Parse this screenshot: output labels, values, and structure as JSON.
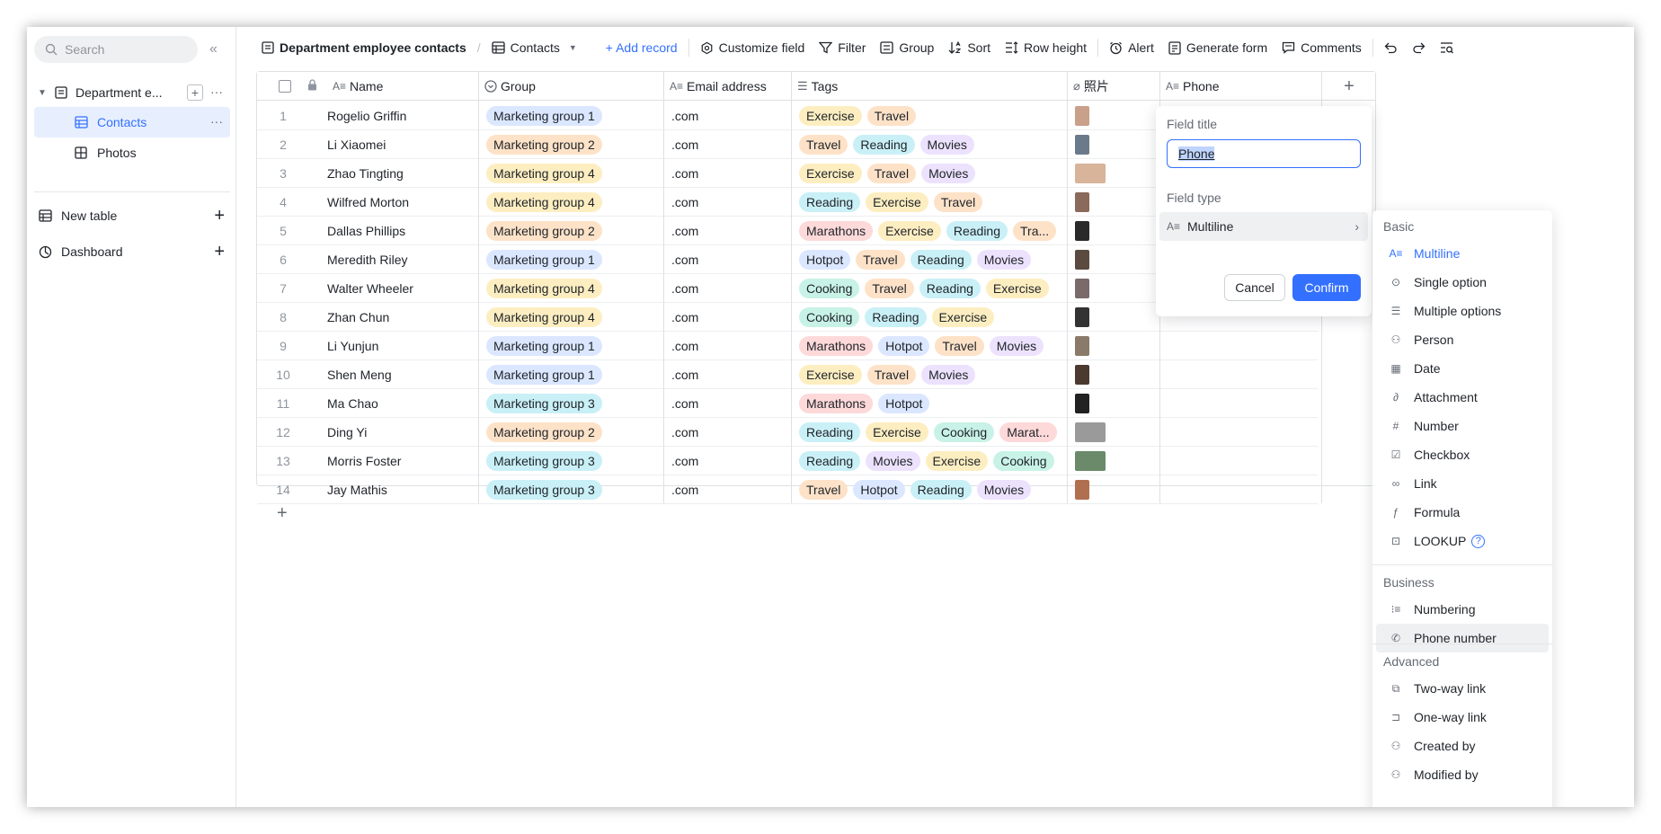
{
  "sidebar": {
    "search_placeholder": "Search",
    "base_name": "Department e...",
    "tables": [
      {
        "label": "Contacts"
      },
      {
        "label": "Photos"
      }
    ],
    "new_table": "New table",
    "dashboard": "Dashboard"
  },
  "toolbar": {
    "base_title": "Department employee contacts",
    "view_name": "Contacts",
    "add_record": "+ Add record",
    "customize_field": "Customize field",
    "filter": "Filter",
    "group": "Group",
    "sort": "Sort",
    "row_height": "Row height",
    "alert": "Alert",
    "generate_form": "Generate form",
    "comments": "Comments"
  },
  "columns": [
    "Name",
    "Group",
    "Email address",
    "Tags",
    "照片",
    "Phone"
  ],
  "rows": [
    {
      "n": "1",
      "name": "Rogelio Griffin",
      "group": "Marketing group 1",
      "email": ".com",
      "tags": [
        "Exercise",
        "Travel"
      ]
    },
    {
      "n": "2",
      "name": "Li Xiaomei",
      "group": "Marketing group 2",
      "email": ".com",
      "tags": [
        "Travel",
        "Reading",
        "Movies"
      ]
    },
    {
      "n": "3",
      "name": "Zhao Tingting",
      "group": "Marketing group 4",
      "email": ".com",
      "tags": [
        "Exercise",
        "Travel",
        "Movies"
      ]
    },
    {
      "n": "4",
      "name": "Wilfred Morton",
      "group": "Marketing group 4",
      "email": ".com",
      "tags": [
        "Reading",
        "Exercise",
        "Travel"
      ]
    },
    {
      "n": "5",
      "name": "Dallas Phillips",
      "group": "Marketing group 2",
      "email": ".com",
      "tags": [
        "Marathons",
        "Exercise",
        "Reading",
        "Tra..."
      ]
    },
    {
      "n": "6",
      "name": "Meredith Riley",
      "group": "Marketing group 1",
      "email": ".com",
      "tags": [
        "Hotpot",
        "Travel",
        "Reading",
        "Movies"
      ]
    },
    {
      "n": "7",
      "name": "Walter Wheeler",
      "group": "Marketing group 4",
      "email": ".com",
      "tags": [
        "Cooking",
        "Travel",
        "Reading",
        "Exercise"
      ]
    },
    {
      "n": "8",
      "name": "Zhan Chun",
      "group": "Marketing group 4",
      "email": ".com",
      "tags": [
        "Cooking",
        "Reading",
        "Exercise"
      ]
    },
    {
      "n": "9",
      "name": "Li Yunjun",
      "group": "Marketing group 1",
      "email": ".com",
      "tags": [
        "Marathons",
        "Hotpot",
        "Travel",
        "Movies"
      ]
    },
    {
      "n": "10",
      "name": "Shen Meng",
      "group": "Marketing group 1",
      "email": ".com",
      "tags": [
        "Exercise",
        "Travel",
        "Movies"
      ]
    },
    {
      "n": "11",
      "name": "Ma Chao",
      "group": "Marketing group 3",
      "email": ".com",
      "tags": [
        "Marathons",
        "Hotpot"
      ]
    },
    {
      "n": "12",
      "name": "Ding Yi",
      "group": "Marketing group 2",
      "email": ".com",
      "tags": [
        "Reading",
        "Exercise",
        "Cooking",
        "Marat..."
      ]
    },
    {
      "n": "13",
      "name": "Morris Foster",
      "group": "Marketing group 3",
      "email": ".com",
      "tags": [
        "Reading",
        "Movies",
        "Exercise",
        "Cooking"
      ]
    },
    {
      "n": "14",
      "name": "Jay Mathis",
      "group": "Marketing group 3",
      "email": ".com",
      "tags": [
        "Travel",
        "Hotpot",
        "Reading",
        "Movies"
      ]
    }
  ],
  "colors": {
    "accent": "#3370ff",
    "group": {
      "Marketing group 1": "#dbe7ff",
      "Marketing group 2": "#fde2c8",
      "Marketing group 3": "#c9f0f6",
      "Marketing group 4": "#fdeec1"
    },
    "tags": {
      "Exercise": "#fdeec1",
      "Travel": "#fde2c8",
      "Reading": "#c9f0f6",
      "Movies": "#ece2fd",
      "Marathons": "#fdd9d9",
      "Hotpot": "#dbe7ff",
      "Cooking": "#c8f2e6",
      "Tra...": "#fde2c8",
      "Marat...": "#fdd9d9"
    }
  },
  "field_popover": {
    "title_label": "Field title",
    "title_value": "Phone",
    "type_label": "Field type",
    "type_value": "Multiline",
    "cancel": "Cancel",
    "confirm": "Confirm"
  },
  "type_menu": {
    "basic_label": "Basic",
    "basic": [
      {
        "label": "Multiline",
        "icon": "multiline-icon"
      },
      {
        "label": "Single option",
        "icon": "single-option-icon"
      },
      {
        "label": "Multiple options",
        "icon": "multiple-options-icon"
      },
      {
        "label": "Person",
        "icon": "person-icon"
      },
      {
        "label": "Date",
        "icon": "date-icon"
      },
      {
        "label": "Attachment",
        "icon": "attachment-icon"
      },
      {
        "label": "Number",
        "icon": "number-icon"
      },
      {
        "label": "Checkbox",
        "icon": "checkbox-icon"
      },
      {
        "label": "Link",
        "icon": "link-icon"
      },
      {
        "label": "Formula",
        "icon": "formula-icon"
      },
      {
        "label": "LOOKUP",
        "icon": "lookup-icon"
      }
    ],
    "business_label": "Business",
    "business": [
      {
        "label": "Numbering",
        "icon": "numbering-icon"
      },
      {
        "label": "Phone number",
        "icon": "phone-icon"
      }
    ],
    "advanced_label": "Advanced",
    "advanced": [
      {
        "label": "Two-way link",
        "icon": "two-way-link-icon"
      },
      {
        "label": "One-way link",
        "icon": "one-way-link-icon"
      },
      {
        "label": "Created by",
        "icon": "person-icon"
      },
      {
        "label": "Modified by",
        "icon": "person-icon"
      }
    ]
  }
}
